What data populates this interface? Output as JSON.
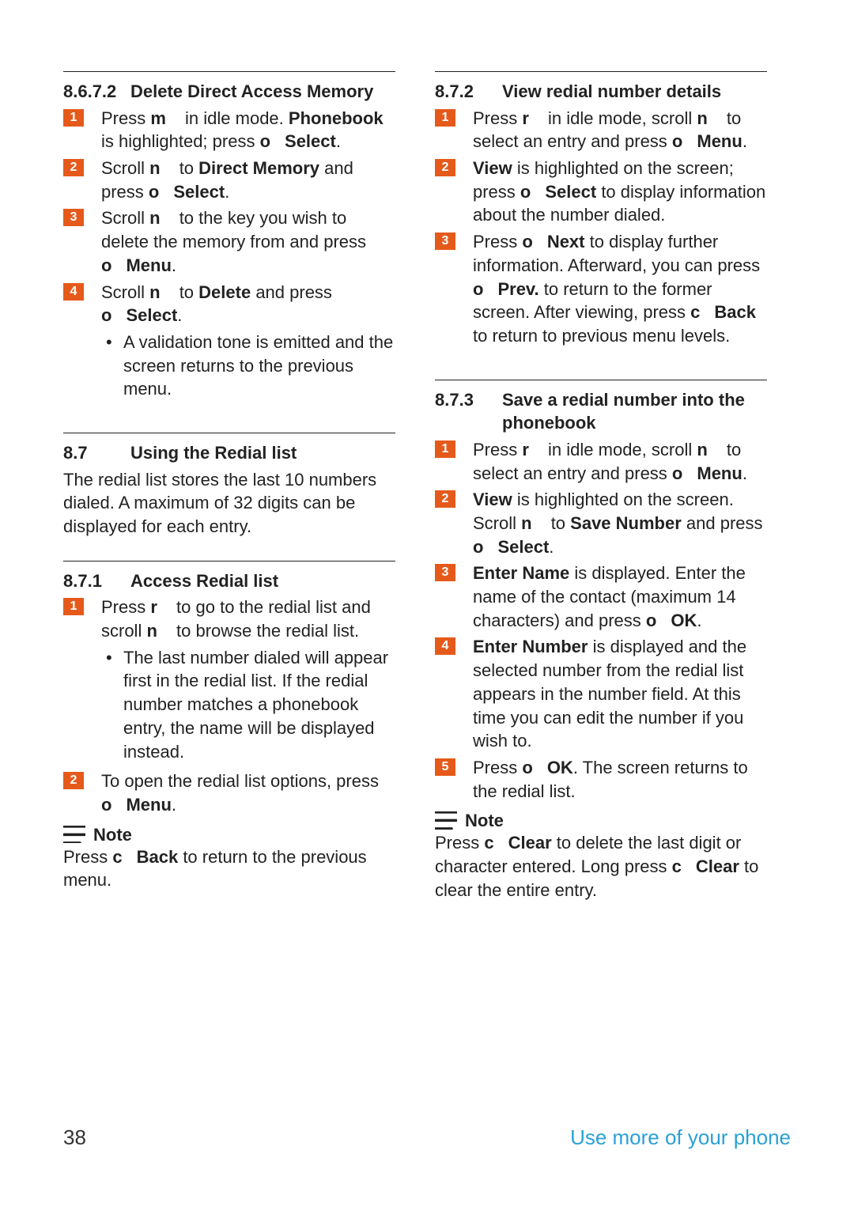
{
  "footer": {
    "page_number": "38",
    "title": "Use more of your phone"
  },
  "left": {
    "s8672": {
      "num": "8.6.7.2",
      "title": "Delete Direct Access Memory",
      "step1_a": "Press ",
      "step1_k1": "m",
      "step1_b": " in idle mode. ",
      "step1_c": "Phonebook",
      "step1_d": " is highlighted; press ",
      "step1_k2": "o",
      "step1_e": "Select",
      "step1_f": ".",
      "step2_a": "Scroll ",
      "step2_k1": "n",
      "step2_b": " to ",
      "step2_c": "Direct Memory",
      "step2_d": " and press ",
      "step2_k2": "o",
      "step2_e": "Select",
      "step2_f": ".",
      "step3_a": "Scroll ",
      "step3_k1": "n",
      "step3_b": " to the key you wish to delete the memory from and press ",
      "step3_k2": "o",
      "step3_c": "Menu",
      "step3_d": ".",
      "step4_a": "Scroll ",
      "step4_k1": "n",
      "step4_b": " to ",
      "step4_c": "Delete",
      "step4_d": " and press ",
      "step4_k2": "o",
      "step4_e": "Select",
      "step4_f": ".",
      "bullet": "A validation tone is emitted and the screen returns to the previous menu."
    },
    "s87": {
      "num": "8.7",
      "title": "Using the Redial list",
      "para": "The redial list stores the last 10 numbers dialed. A maximum of 32 digits can be displayed for each entry."
    },
    "s871": {
      "num": "8.7.1",
      "title": "Access Redial list",
      "step1_a": "Press ",
      "step1_k1": "r",
      "step1_b": " to go to the redial list and scroll ",
      "step1_k2": "n",
      "step1_c": " to browse the redial list.",
      "bullet": "The last number dialed will appear first in the redial list. If the redial number matches a phonebook entry, the name will be displayed instead.",
      "step2_a": "To open the redial list options, press ",
      "step2_k1": "o",
      "step2_b": "Menu",
      "step2_c": ".",
      "note_label": "Note",
      "note_a": "Press ",
      "note_k1": "c",
      "note_b": "Back",
      "note_c": " to return to the previous menu."
    }
  },
  "right": {
    "s872": {
      "num": "8.7.2",
      "title": "View redial number details",
      "step1_a": "Press ",
      "step1_k1": "r",
      "step1_b": " in idle mode, scroll ",
      "step1_k2": "n",
      "step1_c": " to select an entry and press ",
      "step1_k3": "o",
      "step1_d": "Menu",
      "step1_e": ".",
      "step2_a": "View",
      "step2_b": " is highlighted on the screen; press ",
      "step2_k1": "o",
      "step2_c": "Select",
      "step2_d": " to display information about the number dialed.",
      "step3_a": "Press ",
      "step3_k1": "o",
      "step3_b": "Next",
      "step3_c": " to display further information. Afterward, you can press ",
      "step3_k2": "o",
      "step3_d": "Prev.",
      "step3_e": " to return to the former screen. After viewing, press ",
      "step3_k3": "c",
      "step3_f": "Back",
      "step3_g": " to return to previous menu levels."
    },
    "s873": {
      "num": "8.7.3",
      "title": "Save a redial number into the phonebook",
      "step1_a": "Press ",
      "step1_k1": "r",
      "step1_b": " in idle mode, scroll ",
      "step1_k2": "n",
      "step1_c": " to select an entry and press ",
      "step1_k3": "o",
      "step1_d": "Menu",
      "step1_e": ".",
      "step2_a": "View",
      "step2_b": " is highlighted on the screen. Scroll ",
      "step2_k1": "n",
      "step2_c": " to ",
      "step2_d": "Save Number",
      "step2_e": " and press ",
      "step2_k2": "o",
      "step2_f": "Select",
      "step2_g": ".",
      "step3_a": "Enter Name",
      "step3_b": " is displayed. Enter the name of the contact (maximum 14 characters) and press ",
      "step3_k1": "o",
      "step3_c": "OK",
      "step3_d": ".",
      "step4_a": "Enter Number",
      "step4_b": " is displayed and the selected number from the redial list appears in the number field. At this time you can edit the number if you wish to.",
      "step5_a": "Press ",
      "step5_k1": "o",
      "step5_b": "OK",
      "step5_c": ". The screen returns to the redial list.",
      "note_label": "Note",
      "note_a": "Press ",
      "note_k1": "c",
      "note_b": "Clear",
      "note_c": " to delete the last digit or character entered. Long press ",
      "note_k2": "c",
      "note_d": "Clear",
      "note_e": " to clear the entire entry."
    }
  }
}
